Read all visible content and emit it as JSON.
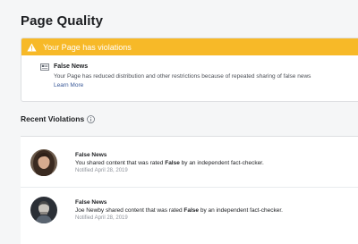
{
  "page": {
    "title": "Page Quality"
  },
  "alert": {
    "title": "Your Page has violations",
    "item_title": "False News",
    "description": "Your Page has reduced distribution and other restrictions because of repeated sharing of false news",
    "learn_more": "Learn More",
    "accent_color": "#f7b928"
  },
  "recent": {
    "title": "Recent Violations",
    "items": [
      {
        "title": "False News",
        "desc_before": "You shared content that was rated ",
        "desc_bold": "False",
        "desc_after": " by an independent fact-checker.",
        "date": "Notified April 28, 2019",
        "avatar": "avatar-woman-dark-hair"
      },
      {
        "title": "False News",
        "desc_before": "Joe Newby shared content that was rated ",
        "desc_bold": "False",
        "desc_after": " by an independent fact-checker.",
        "date": "Notified April 28, 2019",
        "avatar": "avatar-man-dark-background"
      }
    ]
  },
  "icons": {
    "warning": "warning-triangle-icon",
    "news": "newspaper-icon",
    "info": "info-circle-icon"
  }
}
